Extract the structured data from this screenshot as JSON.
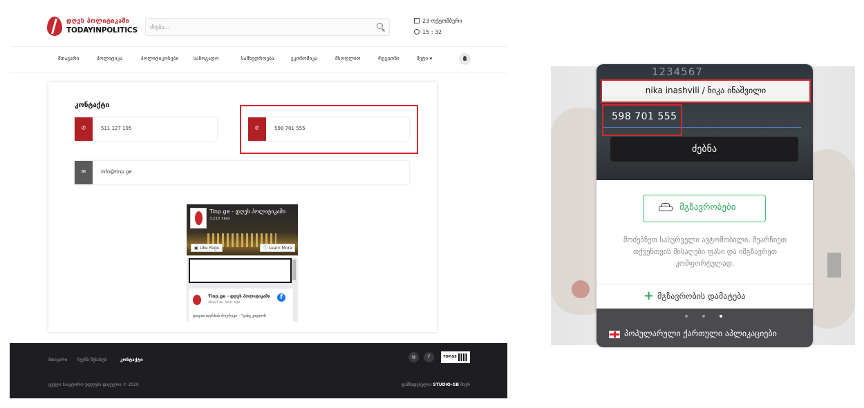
{
  "site": {
    "logo_geo": "დღეს პოლიტიკაში",
    "logo_en": "TODAYINPOLITICS",
    "search_placeholder": "ძიება...",
    "date": "23 ოქტომბერი",
    "time": "15 : 32",
    "nav": [
      "მთავარი",
      "პოლიტიკა",
      "პოლიტიკოსები",
      "საზოგადო",
      "სამხედროება",
      "ეკონომიკა",
      "მსოფლიო",
      "რეგიონი",
      "მეტი"
    ],
    "contact_heading": "კონტაქტი",
    "phone1": "511 127 195",
    "phone2": "598 701 555",
    "email": "info@tinp.ge",
    "fb": {
      "page_title": "Tinp.ge - დღეს პოლიტიკაში",
      "likes": "3,215 likes",
      "like_button": "Like Page",
      "learn_button": "Learn More",
      "post_title": "Tinp.ge - დღეს პოლიტიკაში",
      "post_time": "about an hour ago",
      "post_text": "დავით თარხან-მოურავი - \"ვინც კიდიონ"
    },
    "footer": {
      "links": [
        "მთავარი",
        "ჩვენს შესახებ",
        "კონტაქტი"
      ],
      "active_link": "კონტაქტი",
      "social_icons": [
        "instagram-icon",
        "facebook-icon"
      ],
      "top_badge": "TOP.GE",
      "copyright": "ყველა საავტორო უფლება დაცულია © 2020",
      "credits_prefix": "დამზადებულია",
      "credits_brand": "STUDIO-GB",
      "credits_suffix": "მიერ"
    }
  },
  "ad": {
    "top_digits": "1234567",
    "name": "nika inashvili / ნიკა ინაშვილი",
    "number": "598 701 555",
    "search_button": "ძებნა",
    "trips_button": "მგზავრობები",
    "description": "მოძებნეთ სასურველი ავტომობილი, შეარჩიეთ თქვენთვის მისაღები ფასი და იმგზავრეთ კომფორტულად.",
    "add_trip": "მგზავრობის დამატება",
    "popular_apps": "პოპულარული ქართული აპლიკაციები",
    "dots_total": 3,
    "dots_active_index": 2
  },
  "colors": {
    "brand_red": "#c8272d",
    "highlight_red": "#d9262b",
    "green": "#2fa85e",
    "footer_bg": "#1e1e22"
  }
}
